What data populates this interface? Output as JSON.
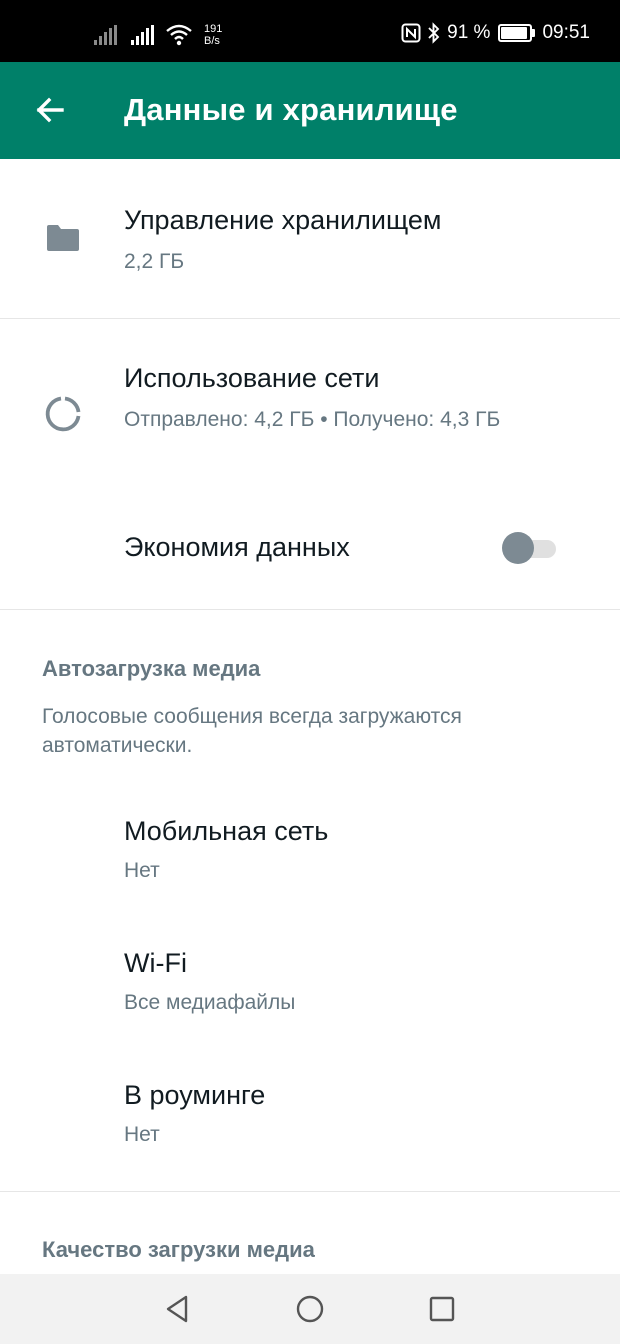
{
  "status_bar": {
    "speed_value": "191",
    "speed_unit": "B/s",
    "battery": "91 %",
    "battery_level": 0.91,
    "time": "09:51"
  },
  "app_bar": {
    "title": "Данные и хранилище",
    "back_icon": "arrow-left-icon"
  },
  "storage": {
    "title": "Управление хранилищем",
    "subtitle": "2,2 ГБ",
    "icon": "folder-icon"
  },
  "network": {
    "title": "Использование сети",
    "subtitle": "Отправлено: 4,2 ГБ • Получено: 4,3 ГБ",
    "icon": "data-usage-icon"
  },
  "data_saver": {
    "label": "Экономия данных",
    "enabled": false
  },
  "autodownload": {
    "heading": "Автозагрузка медиа",
    "note": "Голосовые сообщения всегда загружаются автоматически.",
    "items": [
      {
        "label": "Мобильная сеть",
        "value": "Нет"
      },
      {
        "label": "Wi-Fi",
        "value": "Все медиафайлы"
      },
      {
        "label": "В роуминге",
        "value": "Нет"
      }
    ]
  },
  "quality": {
    "heading": "Качество загрузки медиа"
  },
  "nav_bar": {
    "back": "triangle-back-icon",
    "home": "circle-home-icon",
    "recents": "square-recents-icon"
  },
  "colors": {
    "accent": "#008069",
    "secondary_text": "#667781"
  }
}
